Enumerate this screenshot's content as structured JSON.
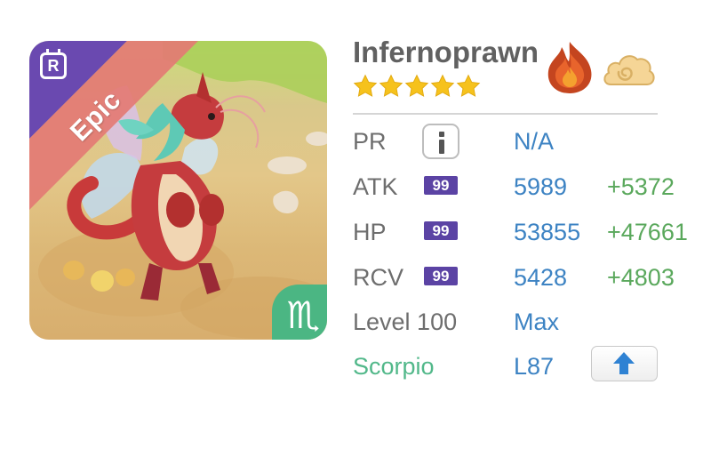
{
  "monster": {
    "name": "Infernoprawn",
    "stars": 5,
    "rarity": "Epic",
    "r_badge": "R",
    "zodiac_symbol": "♏",
    "elements": [
      "fire-icon",
      "cloud-icon"
    ]
  },
  "stats": {
    "pr": {
      "label": "PR",
      "value": "N/A"
    },
    "atk": {
      "label": "ATK",
      "level_badge": "99",
      "value": "5989",
      "bonus": "+5372"
    },
    "hp": {
      "label": "HP",
      "level_badge": "99",
      "value": "53855",
      "bonus": "+47661"
    },
    "rcv": {
      "label": "RCV",
      "level_badge": "99",
      "value": "5428",
      "bonus": "+4803"
    },
    "level": {
      "label": "Level 100",
      "value": "Max"
    },
    "zodiac": {
      "label": "Scorpio",
      "value": "L87"
    }
  },
  "colors": {
    "rarity_ribbon": "#e37b74",
    "corner_purple": "#6a49b0",
    "zodiac_green": "#4bb683",
    "value_blue": "#3d83c3",
    "bonus_green": "#5aa85c",
    "level_badge": "#5b43a4",
    "star_gold": "#f6c21c"
  }
}
